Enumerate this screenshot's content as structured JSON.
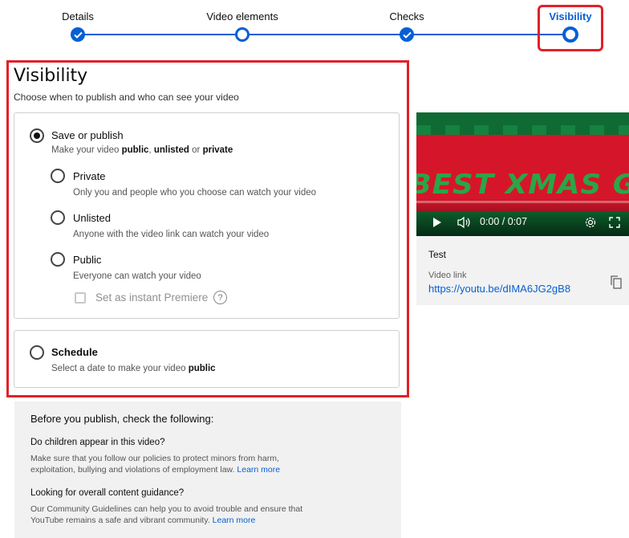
{
  "stepper": {
    "steps": [
      {
        "label": "Details",
        "state": "done"
      },
      {
        "label": "Video elements",
        "state": "pending"
      },
      {
        "label": "Checks",
        "state": "done"
      },
      {
        "label": "Visibility",
        "state": "current"
      }
    ]
  },
  "visibility": {
    "title": "Visibility",
    "subtitle": "Choose when to publish and who can see your video",
    "save_or_publish": {
      "label": "Save or publish",
      "desc_prefix": "Make your video ",
      "desc_public": "public",
      "desc_sep": ", ",
      "desc_unlisted": "unlisted",
      "desc_or": " or ",
      "desc_private": "private",
      "selected": true
    },
    "options": [
      {
        "label": "Private",
        "desc": "Only you and people who you choose can watch your video"
      },
      {
        "label": "Unlisted",
        "desc": "Anyone with the video link can watch your video"
      },
      {
        "label": "Public",
        "desc": "Everyone can watch your video"
      }
    ],
    "premiere_label": "Set as instant Premiere",
    "help_glyph": "?",
    "schedule": {
      "label": "Schedule",
      "desc_prefix": "Select a date to make your video ",
      "desc_bold": "public"
    }
  },
  "preview": {
    "thumbnail_text": "BEST XMAS GAMI",
    "time": "0:00 / 0:07",
    "title": "Test",
    "link_label": "Video link",
    "link": "https://youtu.be/dIMA6JG2gB8"
  },
  "checklist": {
    "heading": "Before you publish, check the following:",
    "items": [
      {
        "question": "Do children appear in this video?",
        "text_1": "Make sure that you follow our policies to protect minors from harm,",
        "text_2": "exploitation, bullying and violations of employment law. ",
        "link": "Learn more"
      },
      {
        "question": "Looking for overall content guidance?",
        "text_1": "Our Community Guidelines can help you to avoid trouble and ensure that",
        "text_2": "YouTube remains a safe and vibrant community. ",
        "link": "Learn more"
      }
    ]
  },
  "colors": {
    "accent": "#065fd4",
    "highlight": "#e02128"
  }
}
